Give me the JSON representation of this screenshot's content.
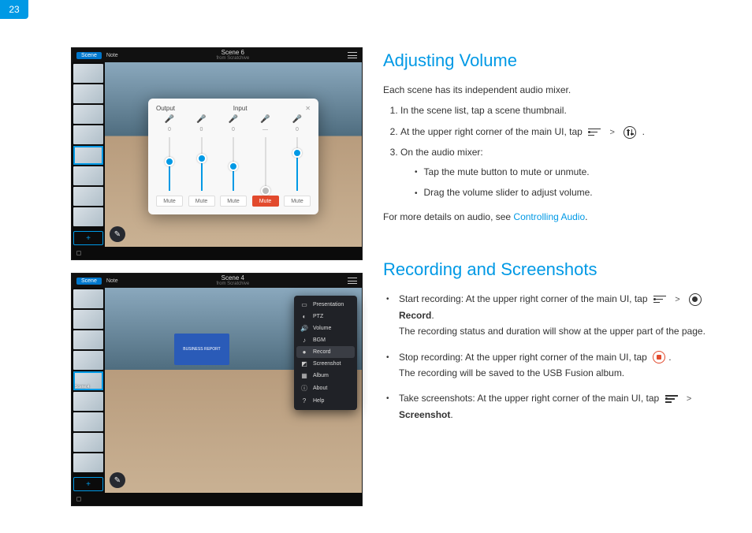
{
  "page_number": "23",
  "screenshots": {
    "top": {
      "top_button": "Scene",
      "top_tab": "Note",
      "title": "Scene 6",
      "subtitle": "from Scratchive",
      "mixer": {
        "tab_output": "Output",
        "tab_input": "Input",
        "channels": [
          {
            "icon": "mic",
            "value": "0",
            "fill": 55,
            "thumb": "blue",
            "mute": "Mute",
            "active": false
          },
          {
            "icon": "mic",
            "value": "0",
            "fill": 60,
            "thumb": "blue",
            "mute": "Mute",
            "active": false
          },
          {
            "icon": "mic",
            "value": "0",
            "fill": 45,
            "thumb": "blue",
            "mute": "Mute",
            "active": false
          },
          {
            "icon": "mic",
            "value": "—",
            "fill": 0,
            "thumb": "gray",
            "mute": "Mute",
            "active": true
          },
          {
            "icon": "mic",
            "value": "0",
            "fill": 70,
            "thumb": "blue",
            "mute": "Mute",
            "active": false
          }
        ]
      }
    },
    "bottom": {
      "top_button": "Scene",
      "top_tab": "Note",
      "title": "Scene 4",
      "subtitle": "from Scratchive",
      "board_text": "BUSINESS REPORT",
      "thumb_sel_label": "Scene 4",
      "menu": [
        {
          "icon": "▭",
          "label": "Presentation"
        },
        {
          "icon": "◐",
          "label": "PTZ"
        },
        {
          "icon": "🔊",
          "label": "Volume"
        },
        {
          "icon": "♪",
          "label": "BGM"
        },
        {
          "icon": "●",
          "label": "Record",
          "selected": true
        },
        {
          "icon": "◩",
          "label": "Screenshot"
        },
        {
          "icon": "▦",
          "label": "Album"
        },
        {
          "icon": "ⓘ",
          "label": "About"
        },
        {
          "icon": "?",
          "label": "Help"
        }
      ]
    }
  },
  "doc": {
    "section1": {
      "heading": "Adjusting Volume",
      "intro": "Each scene has its independent audio mixer.",
      "steps": [
        "In the scene list, tap a scene thumbnail.",
        "At the upper right corner of the main UI, tap",
        "On the audio mixer:"
      ],
      "sub": [
        "Tap the mute button to mute or unmute.",
        "Drag the volume slider to adjust volume."
      ],
      "outro_pre": "For more details on audio, see ",
      "outro_link": "Controlling Audio",
      "outro_post": "."
    },
    "section2": {
      "heading": "Recording and Screenshots",
      "items": {
        "start_pre": "Start recording: At the upper right corner of the main UI, tap",
        "start_kw": "Record",
        "start_post": "The recording status and duration will show at the upper part of the page.",
        "stop_pre": "Stop recording: At the upper right corner of the main UI, tap",
        "stop_post": "The recording will be saved to the USB Fusion album.",
        "shot_pre": "Take screenshots: At the upper right corner of the main UI, tap",
        "shot_kw": "Screenshot"
      }
    }
  }
}
